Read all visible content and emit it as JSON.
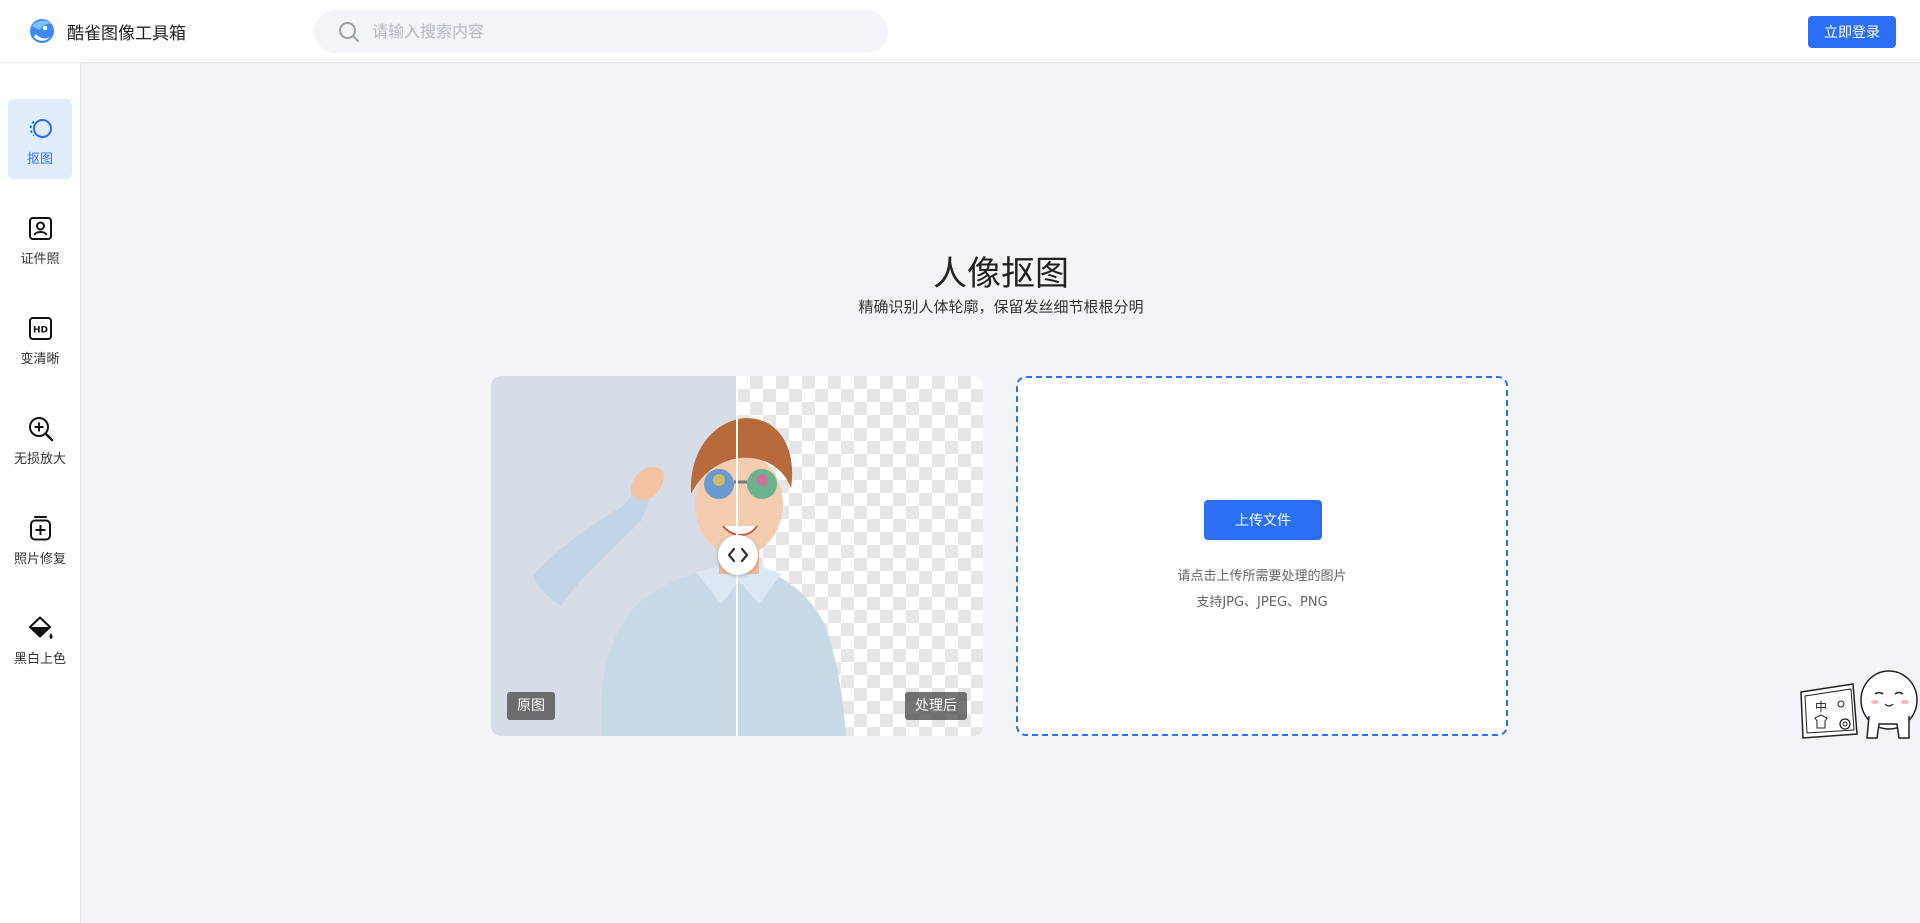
{
  "header": {
    "app_title": "酷雀图像工具箱",
    "logo_icon": "bird-logo-icon",
    "search": {
      "placeholder": "请输入搜索内容",
      "value": "",
      "icon": "search-icon"
    },
    "login_label": "立即登录"
  },
  "sidebar": {
    "items": [
      {
        "label": "抠图",
        "icon": "cutout-icon",
        "active": true
      },
      {
        "label": "证件照",
        "icon": "id-photo-icon",
        "active": false
      },
      {
        "label": "变清晰",
        "icon": "hd-icon",
        "active": false
      },
      {
        "label": "无损放大",
        "icon": "zoom-in-icon",
        "active": false
      },
      {
        "label": "照片修复",
        "icon": "photo-repair-icon",
        "active": false
      },
      {
        "label": "黑白上色",
        "icon": "colorize-icon",
        "active": false
      }
    ]
  },
  "main": {
    "title": "人像抠图",
    "subtitle": "精确识别人体轮廓，保留发丝细节根根分明",
    "demo": {
      "before_label": "原图",
      "after_label": "处理后"
    },
    "upload": {
      "button_label": "上传文件",
      "hint": "请点击上传所需要处理的图片",
      "formats": "支持JPG、JPEG、PNG"
    }
  },
  "colors": {
    "accent": "#2b6ff6",
    "active_bg": "#e1ecfd",
    "page_bg": "#f2f4f8"
  }
}
